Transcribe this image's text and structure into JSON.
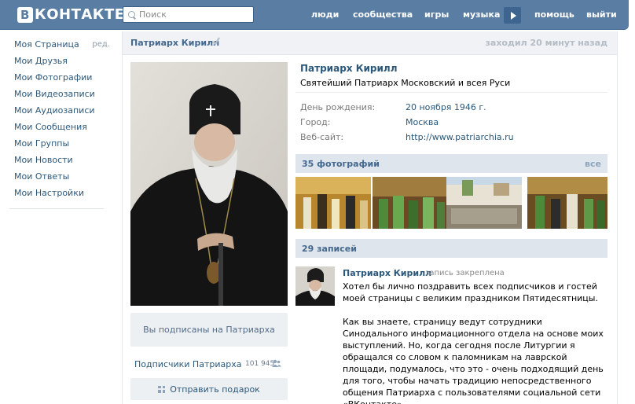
{
  "header": {
    "logo_letter": "В",
    "logo_text": "КОНТАКТЕ",
    "search_placeholder": "Поиск",
    "nav": [
      "люди",
      "сообщества",
      "игры",
      "музыка",
      "помощь",
      "выйти"
    ]
  },
  "left_menu": {
    "items": [
      "Моя Страница",
      "Мои Друзья",
      "Мои Фотографии",
      "Мои Видеозаписи",
      "Мои Аудиозаписи",
      "Мои Сообщения",
      "Мои Группы",
      "Мои Новости",
      "Мои Ответы",
      "Мои Настройки"
    ],
    "edit_label": "ред."
  },
  "page": {
    "name": "Патриарх Кирилл",
    "last_seen": "заходил 20 минут назад"
  },
  "profile": {
    "name": "Патриарх Кирилл",
    "status": "Святейший Патриарх Московский и всея Руси",
    "fields": [
      {
        "label": "День рождения:",
        "value": "20 ноября 1946 г."
      },
      {
        "label": "Город:",
        "value": "Москва"
      },
      {
        "label": "Веб-сайт:",
        "value": "http://www.patriarchia.ru"
      }
    ]
  },
  "actions": {
    "subscribed": "Вы подписаны на Патриарха",
    "subscribers_label": "Подписчики Патриарха",
    "subscribers_count": "101 945",
    "gift": "Отправить подарок"
  },
  "photos": {
    "title": "35 фотографий",
    "all_link": "все"
  },
  "wall": {
    "title": "29 записей",
    "post": {
      "author": "Патриарх Кирилл",
      "pinned": "запись закреплена",
      "text": "Хотел бы лично поздравить всех подписчиков и гостей моей страницы с великим праздником Пятидесятницы.\n\nКак вы знаете, страницу ведут сотрудники Синодального информационного отдела на основе моих выступлений. Но, когда сегодня после Литургии я обращался со словом к паломникам на лаврской площади, подумалось, что это - очень подходящий день для того, чтобы начать традицию непосредственного общения Патриарха с пользователями социальной сети «ВКонтакте»."
    }
  },
  "colors": {
    "header_bg": "#597da3",
    "link": "#2b587a",
    "section_bg": "#dee5ec"
  }
}
